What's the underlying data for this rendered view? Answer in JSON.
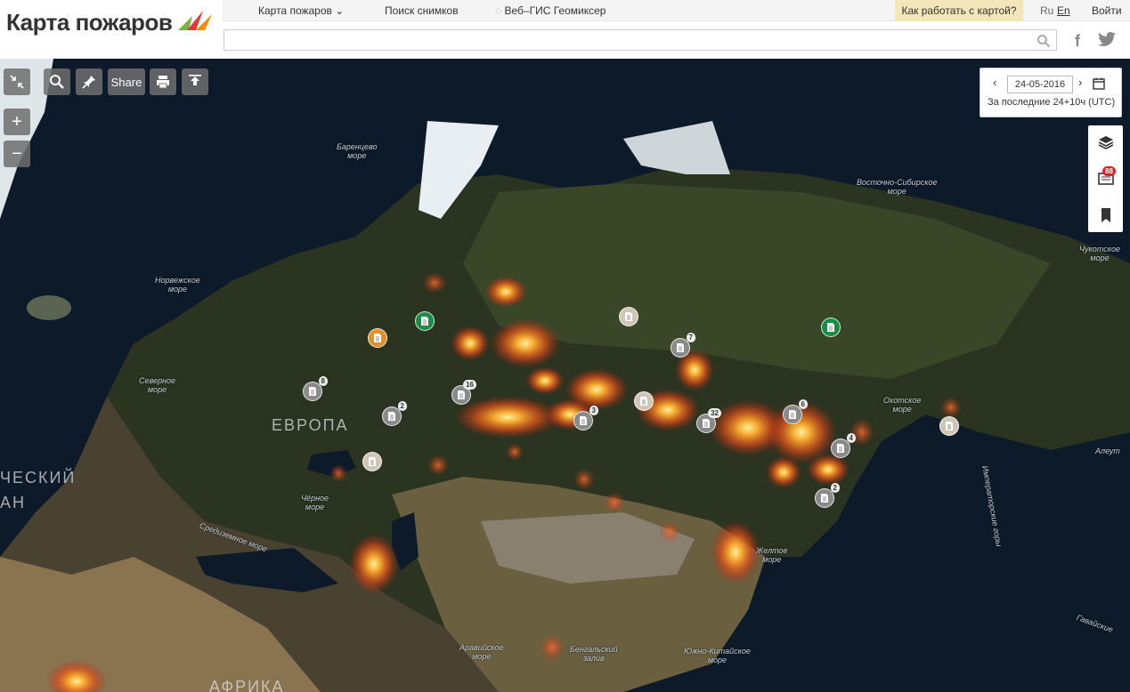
{
  "header": {
    "logo_text": "Карта пожаров",
    "nav": {
      "fires": "Карта пожаров",
      "imagery_search": "Поиск снимков",
      "geomixer": "Веб–ГИС Геомиксер"
    },
    "help": "Как работать с картой?",
    "lang_ru": "Ru",
    "lang_en": "En",
    "login": "Войти",
    "search_placeholder": ""
  },
  "toolbar": {
    "share_label": "Share",
    "zoom_in": "+",
    "zoom_out": "−"
  },
  "date_panel": {
    "date": "24-05-2016",
    "range_text": "За последние 24+10ч (UTC)"
  },
  "right_panel": {
    "badge_count": "88"
  },
  "map_labels": {
    "barents": "Баренцево\nморе",
    "norwegian": "Норвежское\nморе",
    "north_sea": "Северное\nморе",
    "east_siberian": "Восточно-Сибирское\nморе",
    "chukchi": "Чукотское\nморе",
    "okhotsk": "Охотское\nморе",
    "black_sea": "Чёрное\nморе",
    "mediterranean": "Средиземное море",
    "yellow_sea": "Желтое\nморе",
    "arabian_sea": "Аравийское\nморе",
    "bengal": "Бенгальский\nзалив",
    "south_china": "Южно-Китайское\nморе",
    "aleutian": "Алеут",
    "emperor": "Императорские горы",
    "hawaiian": "Гавайские",
    "europe": "ЕВРОПА",
    "africa": "АФРИКА",
    "atlantic_1": "ЧЕСКИЙ",
    "atlantic_2": "АН"
  },
  "markers": [
    {
      "count": "8",
      "color": "gray"
    },
    {
      "count": "2",
      "color": "gray"
    },
    {
      "count": "16",
      "color": "gray"
    },
    {
      "count": "3",
      "color": "gray"
    },
    {
      "count": "7",
      "color": "gray"
    },
    {
      "count": "32",
      "color": "gray"
    },
    {
      "count": "6",
      "color": "gray"
    },
    {
      "count": "4",
      "color": "gray"
    },
    {
      "count": "2",
      "color": "gray"
    },
    {
      "count": "",
      "color": "orange"
    },
    {
      "count": "",
      "color": "green"
    },
    {
      "count": "",
      "color": "green"
    },
    {
      "count": "",
      "color": "beige"
    },
    {
      "count": "",
      "color": "beige"
    },
    {
      "count": "",
      "color": "beige"
    },
    {
      "count": "",
      "color": "beige"
    }
  ],
  "colors": {
    "accent_help": "#f3e6b8",
    "badge": "#e02020",
    "fire_core": "#ffb030",
    "fire_edge": "#d03010",
    "marker_gray": "#8a8a8a",
    "marker_orange": "#e0902a",
    "marker_green": "#1f8a45",
    "marker_beige": "#cfc6b6"
  }
}
